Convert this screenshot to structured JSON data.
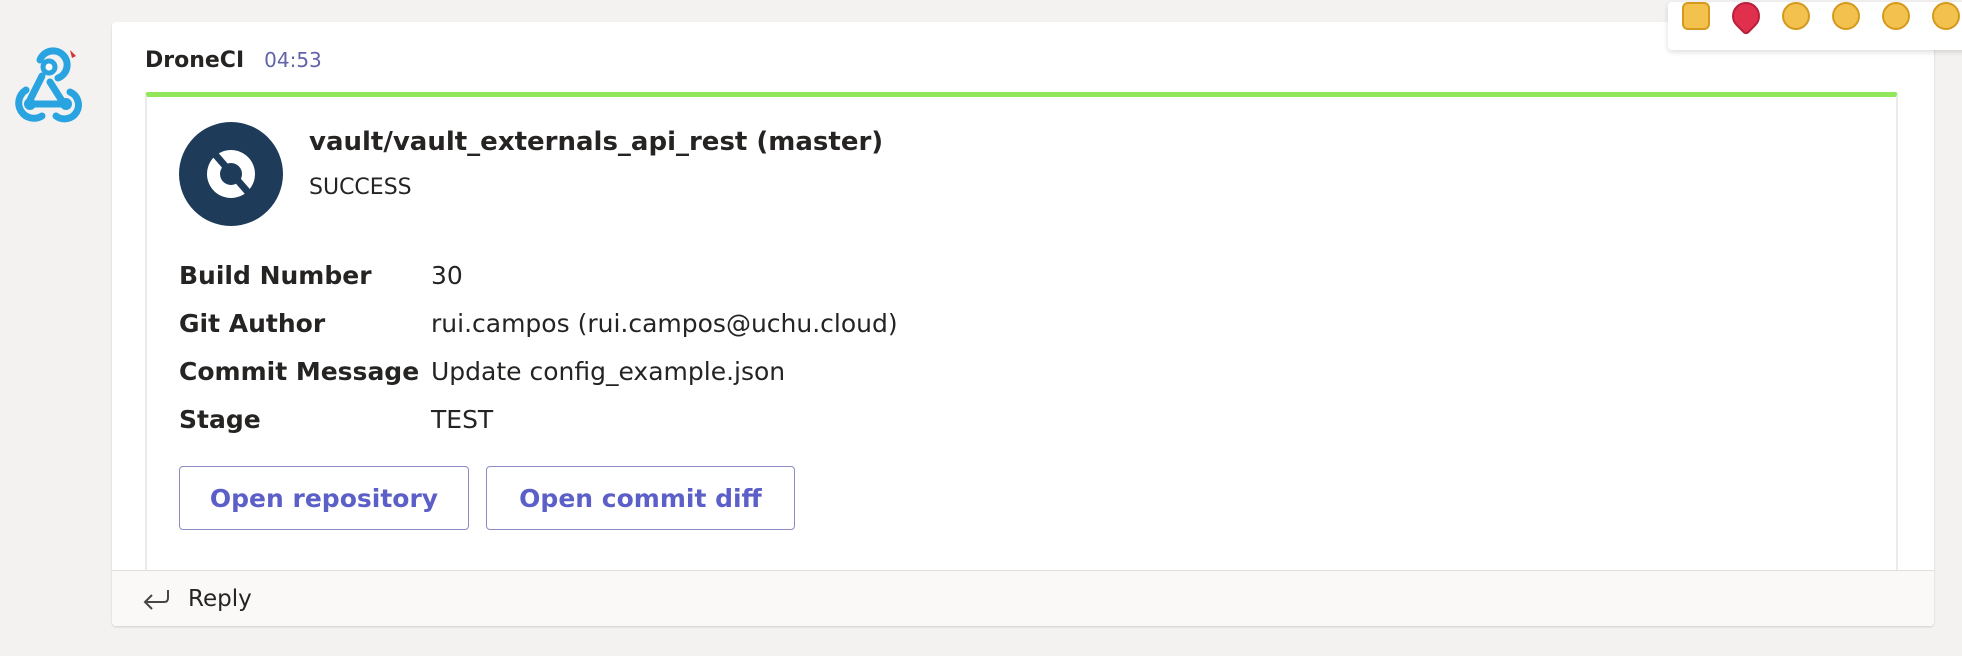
{
  "message": {
    "sender": "DroneCI",
    "time": "04:53"
  },
  "card": {
    "title": "vault/vault_externals_api_rest (master)",
    "status": "SUCCESS",
    "facts": [
      {
        "key": "Build Number",
        "value": "30"
      },
      {
        "key": "Git Author",
        "value": "rui.campos (rui.campos@uchu.cloud)"
      },
      {
        "key": "Commit Message",
        "value": "Update config_example.json"
      },
      {
        "key": "Stage",
        "value": "TEST"
      }
    ],
    "actions": [
      {
        "label": "Open repository"
      },
      {
        "label": "Open commit diff"
      }
    ]
  },
  "reply": {
    "label": "Reply"
  },
  "icons": {
    "avatar": "webhook-icon",
    "card_logo": "drone-logo-icon",
    "reply": "reply-arrow-icon",
    "reactions": [
      "like-emoji-icon",
      "heart-emoji-icon",
      "laugh-emoji-icon",
      "surprised-emoji-icon",
      "sad-emoji-icon",
      "angry-emoji-icon"
    ]
  },
  "colors": {
    "accent": "#6264a7",
    "success_bar": "#92e65a",
    "logo_bg": "#1f3b5a",
    "webhook": "#2aa4e0"
  }
}
